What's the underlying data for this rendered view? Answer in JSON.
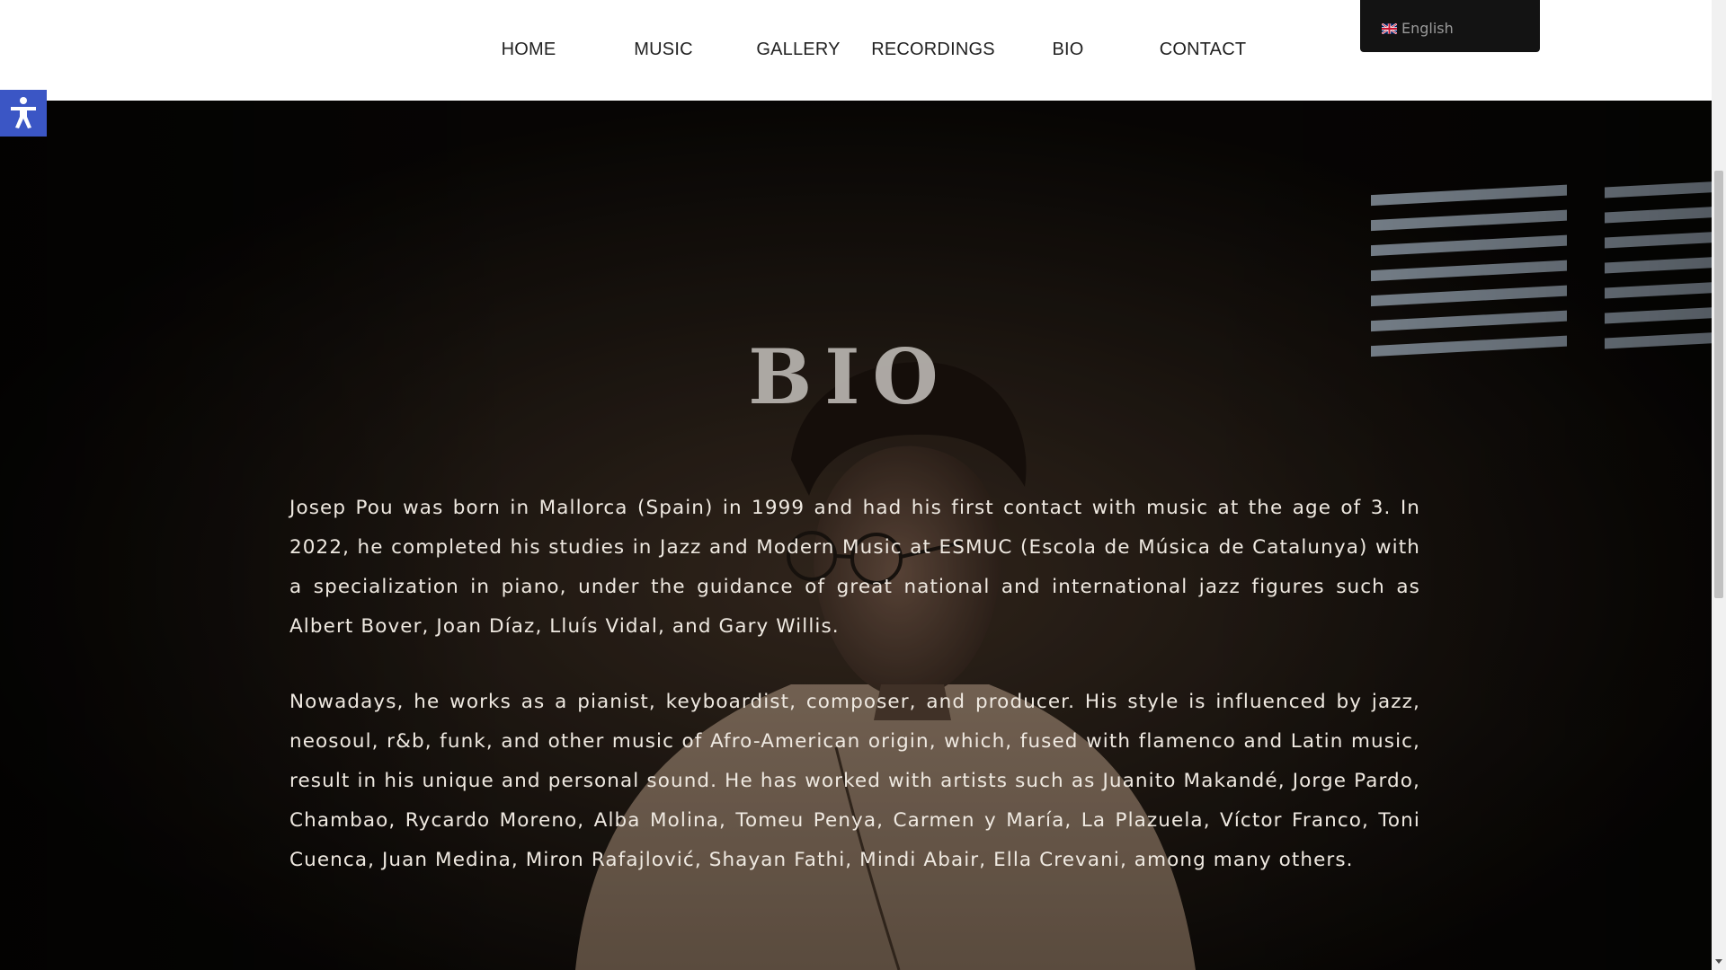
{
  "nav": {
    "items": [
      {
        "label": "HOME"
      },
      {
        "label": "MUSIC"
      },
      {
        "label": "GALLERY"
      },
      {
        "label": "RECORDINGS"
      },
      {
        "label": "BIO"
      },
      {
        "label": "CONTACT"
      }
    ]
  },
  "language": {
    "label": "English",
    "flag_icon": "uk-flag-icon"
  },
  "accessibility": {
    "icon": "accessibility-person-icon",
    "color": "#3b56c5"
  },
  "bio": {
    "title": "BIO",
    "paragraph_1": "Josep Pou was born in Mallorca (Spain) in 1999 and had his first contact with music at the age of 3. In 2022, he completed his studies in Jazz and Modern Music at ESMUC (Escola de Música de Catalunya) with a specialization in piano, under the guidance of great national and international jazz figures such as Albert Bover, Joan Díaz, Lluís Vidal, and Gary Willis.",
    "paragraph_2": "Nowadays, he works as a pianist, keyboardist, composer, and producer. His style is influenced by jazz, neosoul, r&b, funk, and other music of Afro-American origin, which, fused with flamenco and Latin music, result in his unique and personal sound. He has worked with artists such as Juanito Makandé, Jorge Pardo, Chambao, Rycardo Moreno, Alba Molina, Tomeu Penya, Carmen y María, La Plazuela, Víctor Franco, Toni Cuenca, Juan Medina, Miron Rafajlović, Shayan Fathi, Mindi Abair, Ella Crevani, among many others."
  }
}
